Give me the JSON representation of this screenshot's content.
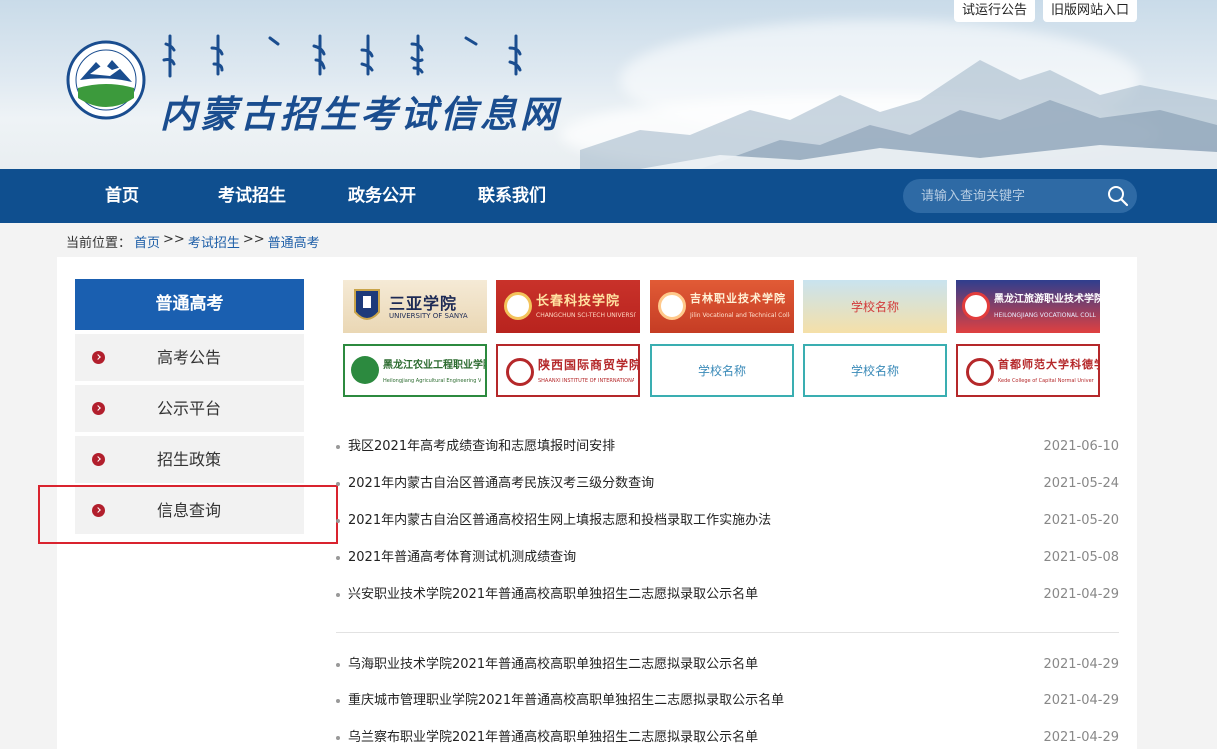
{
  "header": {
    "top_links": [
      "试运行公告",
      "旧版网站入口"
    ],
    "title": "内蒙古招生考试信息网"
  },
  "nav": {
    "items": [
      "首页",
      "考试招生",
      "政务公开",
      "联系我们"
    ],
    "search_placeholder": "请输入查询关键字"
  },
  "breadcrumb": {
    "prefix": "当前位置：",
    "items": [
      "首页",
      "考试招生",
      "普通高考"
    ],
    "separator": ">>"
  },
  "sidebar": {
    "title": "普通高考",
    "items": [
      "高考公告",
      "公示平台",
      "招生政策",
      "信息查询"
    ]
  },
  "schools": [
    {
      "name": "三亚学院",
      "sub": "UNIVERSITY OF SANYA"
    },
    {
      "name": "长春科技学院",
      "sub": "CHANGCHUN SCI-TECH UNIVERSITY"
    },
    {
      "name": "吉林职业技术学院",
      "sub": "Jilin Vocational and Technical College"
    },
    {
      "name": "学校名称",
      "sub": ""
    },
    {
      "name": "黑龙江旅游职业技术学院",
      "sub": "HEILONGJIANG VOCATIONAL COLLEGE OF TOURISM"
    },
    {
      "name": "黑龙江农业工程职业学院",
      "sub": "Heilongjiang Agricultural Engineering Vocational College"
    },
    {
      "name": "陕西国际商贸学院",
      "sub": "SHAANXI INSTITUTE OF INTERNATIONAL TRADE & COMMERCE"
    },
    {
      "name": "学校名称",
      "sub": ""
    },
    {
      "name": "学校名称",
      "sub": ""
    },
    {
      "name": "首都师范大学科德学院",
      "sub": "Kede College of Capital Normal University"
    }
  ],
  "news": [
    {
      "title": "我区2021年高考成绩查询和志愿填报时间安排",
      "date": "2021-06-10"
    },
    {
      "title": "2021年内蒙古自治区普通高考民族汉考三级分数查询",
      "date": "2021-05-24"
    },
    {
      "title": "2021年内蒙古自治区普通高校招生网上填报志愿和投档录取工作实施办法",
      "date": "2021-05-20"
    },
    {
      "title": "2021年普通高考体育测试机测成绩查询",
      "date": "2021-05-08"
    },
    {
      "title": "兴安职业技术学院2021年普通高校高职单独招生二志愿拟录取公示名单",
      "date": "2021-04-29"
    },
    {
      "title": "乌海职业技术学院2021年普通高校高职单独招生二志愿拟录取公示名单",
      "date": "2021-04-29"
    },
    {
      "title": "重庆城市管理职业学院2021年普通高校高职单独招生二志愿拟录取公示名单",
      "date": "2021-04-29"
    },
    {
      "title": "乌兰察布职业学院2021年普通高校高职单独招生二志愿拟录取公示名单",
      "date": "2021-04-29"
    }
  ],
  "colors": {
    "nav_bg": "#0f4f8f",
    "sidebar_title_bg": "#1a5fb0",
    "bullet_red": "#b21f2d",
    "highlight_red": "#d9232e",
    "link_blue": "#1e5fa8"
  }
}
